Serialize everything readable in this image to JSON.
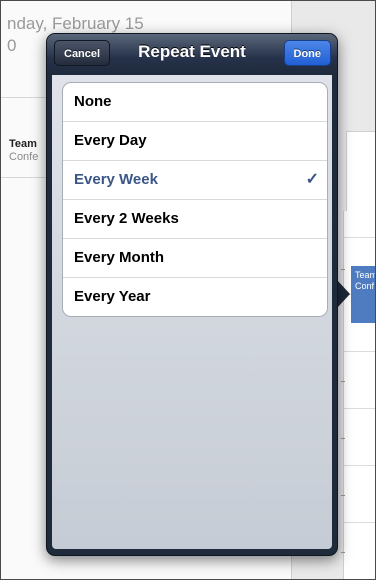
{
  "background": {
    "date_text": "nday, February 15",
    "date_text_line2": "0",
    "left_event": {
      "title": "Team",
      "subtitle": "Confe"
    },
    "right_event": {
      "title": "Team",
      "subtitle": "Conf"
    }
  },
  "popover": {
    "title": "Repeat Event",
    "cancel_label": "Cancel",
    "done_label": "Done",
    "options": [
      {
        "label": "None",
        "selected": false
      },
      {
        "label": "Every Day",
        "selected": false
      },
      {
        "label": "Every Week",
        "selected": true
      },
      {
        "label": "Every 2 Weeks",
        "selected": false
      },
      {
        "label": "Every Month",
        "selected": false
      },
      {
        "label": "Every Year",
        "selected": false
      }
    ],
    "checkmark": "✓"
  },
  "colors": {
    "selected_text": "#3a5687",
    "done_button": "#2b6be0",
    "header": "#26324a"
  }
}
